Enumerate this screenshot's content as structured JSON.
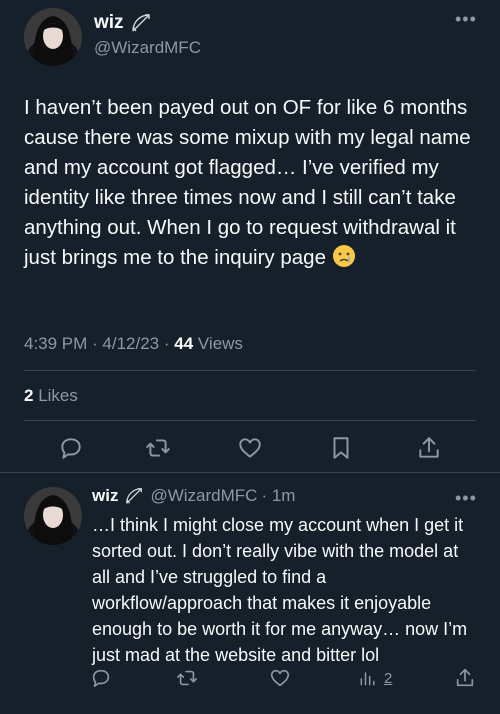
{
  "tweet": {
    "display_name": "wiz",
    "handle": "@WizardMFC",
    "text": "I haven’t been payed out on OF for like 6 months cause there was some mixup with my legal name and my account got flagged… I’ve verified my identity like three times now and I still can’t take anything out. When I go to request withdrawal it just brings me to the inquiry page",
    "time": "4:39 PM · 4/12/23 · ",
    "views_count": "44",
    "views_label": " Views",
    "likes_count": "2",
    "likes_label": " Likes"
  },
  "reply": {
    "display_name": "wiz",
    "handle": "@WizardMFC",
    "time": "· 1m",
    "text": "…I think I might close my account when I get it sorted out. I don’t really vibe with the model at all and I’ve struggled to find a workflow/approach that makes it enjoyable enough to be worth it for me anyway… now I’m just mad at the website and bitter lol",
    "views_count": "2"
  },
  "icons": [
    "more-icon",
    "bow-arrow-icon",
    "reply-icon",
    "retweet-icon",
    "like-icon",
    "bookmark-icon",
    "share-icon",
    "views-icon",
    "crying-face-emoji"
  ],
  "colors": {
    "background": "#15202b",
    "text": "#f7f9f9",
    "muted": "#8b98a5",
    "divider": "#38444d"
  }
}
